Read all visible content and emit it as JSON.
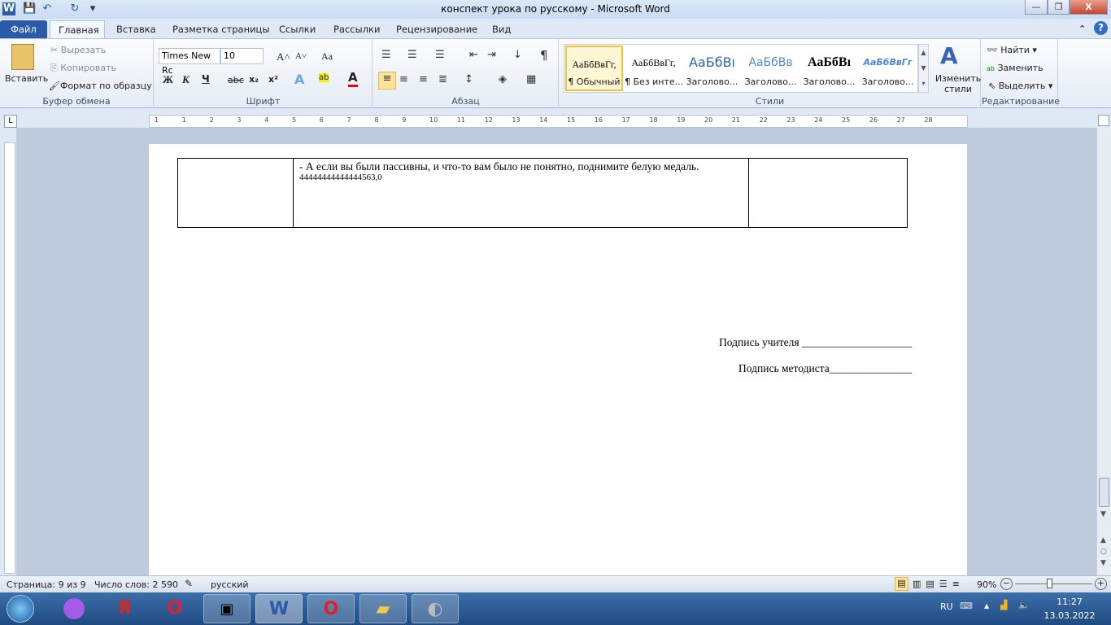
{
  "window": {
    "title": "конспект урока по русскому  -  Microsoft Word",
    "minimize": "—",
    "maximize": "❐",
    "close": "X"
  },
  "quick_access": {
    "app_icon": "W",
    "save": "💾",
    "undo": "↶",
    "redo": "↻",
    "customize": "▾"
  },
  "tabs": [
    "Файл",
    "Главная",
    "Вставка",
    "Разметка страницы",
    "Ссылки",
    "Рассылки",
    "Рецензирование",
    "Вид"
  ],
  "clipboard": {
    "paste": "Вставить",
    "cut": "Вырезать",
    "copy": "Копировать",
    "format_painter": "Формат по образцу",
    "label": "Буфер обмена"
  },
  "font": {
    "name": "Times New Rc",
    "size": "10",
    "label": "Шрифт",
    "bold": "Ж",
    "italic": "К",
    "underline": "Ч",
    "strike": "abc",
    "sub": "x₂",
    "sup": "x²",
    "grow": "A˄",
    "shrink": "A˅",
    "case": "Aa"
  },
  "paragraph": {
    "label": "Абзац",
    "pilcrow": "¶"
  },
  "styles": {
    "label": "Стили",
    "items": [
      {
        "sample": "АаБбВвГг,",
        "name": "¶ Обычный",
        "selected": true
      },
      {
        "sample": "АаБбВвГг,",
        "name": "¶ Без инте..."
      },
      {
        "sample": "АаБбВı",
        "name": "Заголово..."
      },
      {
        "sample": "АаБбВв",
        "name": "Заголово..."
      },
      {
        "sample": "АаБбВı",
        "name": "Заголово..."
      },
      {
        "sample": "АаБбВвГг",
        "name": "Заголово..."
      }
    ],
    "change": "Изменить стили"
  },
  "editing": {
    "label": "Редактирование",
    "find": "Найти",
    "replace": "Заменить",
    "select": "Выделить"
  },
  "ruler_numbers": [
    "1",
    "1",
    "2",
    "3",
    "4",
    "5",
    "6",
    "7",
    "8",
    "9",
    "10",
    "11",
    "12",
    "13",
    "14",
    "15",
    "16",
    "17",
    "18",
    "19",
    "20",
    "21",
    "22",
    "23",
    "24",
    "25",
    "26",
    "27",
    "28"
  ],
  "document": {
    "cell_text": "- А если вы были пассивны, и что-то вам было не понятно, поднимите белую медаль.",
    "cell_text2": "44444444444444563,0",
    "sig_teacher": "Подпись учителя ____________________",
    "sig_methodist": "Подпись методиста_______________"
  },
  "status": {
    "page": "Страница: 9 из 9",
    "words": "Число слов: 2 590",
    "language": "русский",
    "zoom": "90%",
    "zoom_percent": 90
  },
  "taskbar": {
    "lang": "RU",
    "time": "11:27",
    "date": "13.03.2022"
  }
}
